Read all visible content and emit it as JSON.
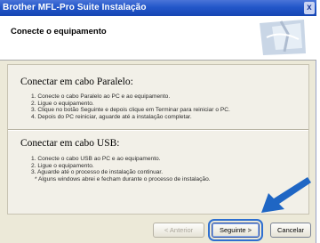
{
  "window": {
    "title": "Brother MFL-Pro Suite Instalação",
    "close_glyph": "x"
  },
  "header": {
    "title": "Conecte o equipamento"
  },
  "sections": [
    {
      "heading": "Conectar em cabo Paralelo:",
      "items": [
        "1. Conecte o cabo Paralelo ao PC e ao equipamento.",
        "2. Ligue o equipamento.",
        "3. Clique no botão Seguinte e depois clique em Terminar para reiniciar o PC.",
        "4. Depois do PC reiniciar, aguarde até a instalação completar."
      ]
    },
    {
      "heading": "Conectar em cabo USB:",
      "items": [
        "1. Conecte o cabo USB ao PC e ao equipamento.",
        "2. Ligue o equipamento.",
        "3. Aguarde até o processo de instalação continuar.",
        "* Alguns windows abrei e fecham durante o processo de instalação."
      ]
    }
  ],
  "buttons": {
    "back": "< Anterior",
    "next": "Seguinte >",
    "cancel": "Cancelar"
  },
  "colors": {
    "titlebar": "#2357c9",
    "arrow": "#1f66c4",
    "dialog_bg": "#ece9d8"
  },
  "icons": {
    "arrow": "pointer-arrow-icon",
    "header_graphic": "wizard-graphic-icon"
  }
}
